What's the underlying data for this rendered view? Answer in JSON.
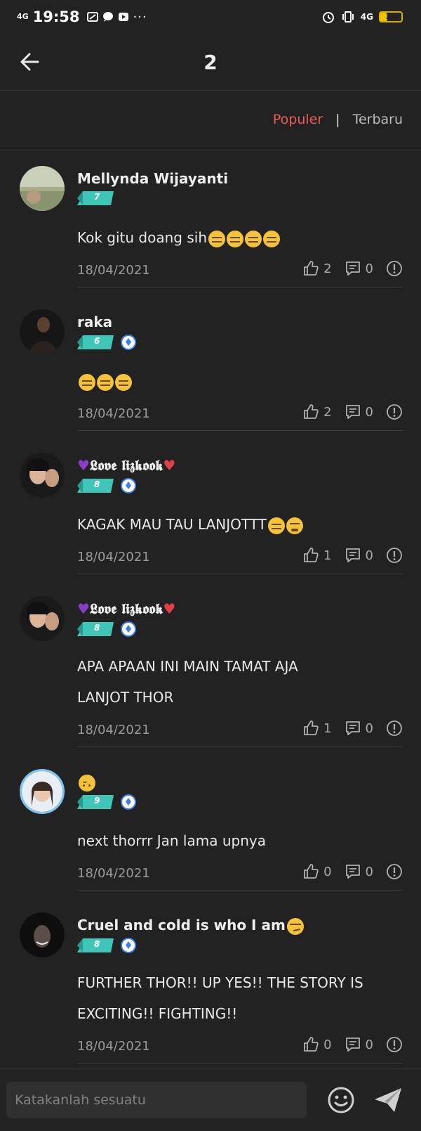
{
  "status_bar": {
    "network": "4G",
    "time": "19:58",
    "dots": "···",
    "net_right": "4G",
    "battery": "32",
    "battery_level": 0.32
  },
  "header": {
    "title": "2",
    "back_icon": "arrow-left-icon"
  },
  "sort": {
    "popular": "Populer",
    "divider": "|",
    "newest": "Terbaru",
    "active_color": "#ee5a57"
  },
  "comments": [
    {
      "user": "Mellynda Wijayanti",
      "level": "7",
      "vip": false,
      "text": "Kok gitu doang sih",
      "date": "18/04/2021",
      "likes": "2",
      "replies": "0"
    },
    {
      "user": "raka",
      "level": "6",
      "vip": true,
      "text": "",
      "date": "18/04/2021",
      "likes": "2",
      "replies": "0"
    },
    {
      "user": "𝕷𝖔𝖛𝖊 𝖑𝖎𝖟𝖐𝖔𝖔𝖐",
      "level": "8",
      "vip": true,
      "text": "KAGAK MAU TAU LANJOTTT",
      "date": "18/04/2021",
      "likes": "1",
      "replies": "0"
    },
    {
      "user": "𝕷𝖔𝖛𝖊 𝖑𝖎𝖟𝖐𝖔𝖔𝖐",
      "level": "8",
      "vip": true,
      "text_line1": "APA APAAN INI MAIN TAMAT AJA",
      "text_line2": "LANJOT THOR",
      "date": "18/04/2021",
      "likes": "1",
      "replies": "0"
    },
    {
      "user": "",
      "level": "9",
      "vip": true,
      "text": "next thorrr Jan lama upnya",
      "date": "18/04/2021",
      "likes": "0",
      "replies": "0"
    },
    {
      "user": "Cruel and cold is who I am",
      "level": "8",
      "vip": true,
      "text_line1": "FURTHER THOR!! UP YES!! THE STORY IS",
      "text_line2": "EXCITING!! FIGHTING!!",
      "date": "18/04/2021",
      "likes": "0",
      "replies": "0"
    }
  ],
  "composer": {
    "placeholder": "Katakanlah sesuatu",
    "emoji_icon": "smiley-icon",
    "send_icon": "send-icon"
  },
  "colors": {
    "background": "#222223",
    "accent": "#ee5a57",
    "level_badge": "#3fc6b8",
    "vip_badge": "#3b7ee8"
  }
}
